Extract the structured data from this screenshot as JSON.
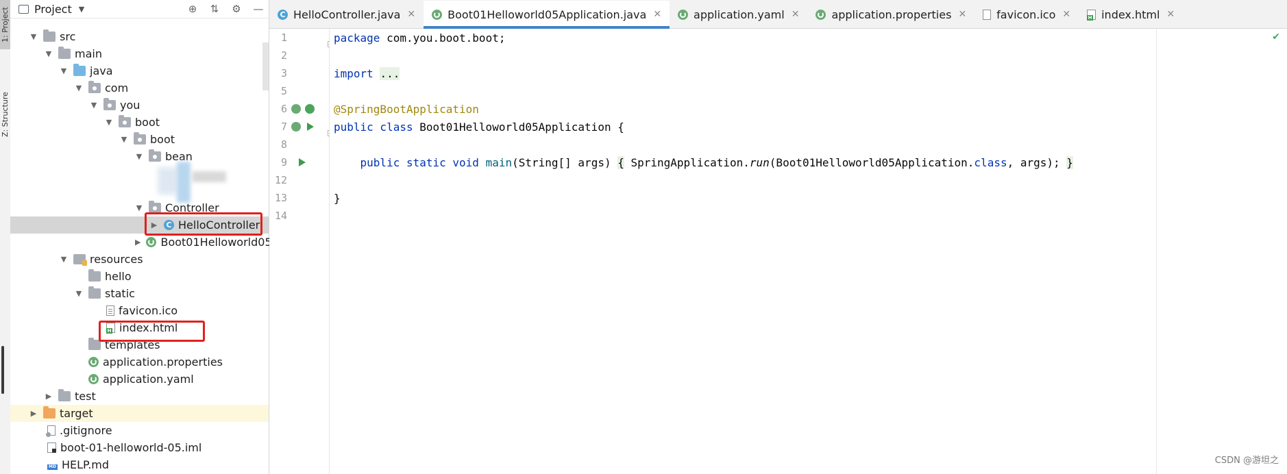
{
  "tool_strip": {
    "tabs": [
      "1: Project",
      "Z: Structure"
    ]
  },
  "project_panel": {
    "title": "Project",
    "tree": [
      {
        "label": "src",
        "icon": "folder",
        "expanded": true
      },
      {
        "label": "main",
        "icon": "folder",
        "expanded": true
      },
      {
        "label": "java",
        "icon": "source-folder",
        "expanded": true
      },
      {
        "label": "com",
        "icon": "package",
        "expanded": true
      },
      {
        "label": "you",
        "icon": "package",
        "expanded": true
      },
      {
        "label": "boot",
        "icon": "package",
        "expanded": true
      },
      {
        "label": "boot",
        "icon": "package",
        "expanded": true
      },
      {
        "label": "bean",
        "icon": "package",
        "expanded": true
      },
      {
        "label": "Controller",
        "icon": "package",
        "expanded": true
      },
      {
        "label": "HelloController",
        "icon": "class",
        "expanded": false,
        "selected": true
      },
      {
        "label": "Boot01Helloworld05",
        "icon": "spring-boot-class",
        "expanded": false
      },
      {
        "label": "resources",
        "icon": "resources-folder",
        "expanded": true
      },
      {
        "label": "hello",
        "icon": "folder"
      },
      {
        "label": "static",
        "icon": "folder",
        "expanded": true
      },
      {
        "label": "favicon.ico",
        "icon": "file"
      },
      {
        "label": "index.html",
        "icon": "html-file"
      },
      {
        "label": "templates",
        "icon": "folder"
      },
      {
        "label": "application.properties",
        "icon": "spring-config"
      },
      {
        "label": "application.yaml",
        "icon": "spring-config"
      },
      {
        "label": "test",
        "icon": "folder",
        "expanded": false
      },
      {
        "label": "target",
        "icon": "excluded-folder",
        "expanded": false
      },
      {
        "label": ".gitignore",
        "icon": "gitignore-file"
      },
      {
        "label": "boot-01-helloworld-05.iml",
        "icon": "iml-file"
      },
      {
        "label": "HELP.md",
        "icon": "markdown-file"
      }
    ]
  },
  "tabs": [
    {
      "label": "HelloController.java",
      "icon": "class",
      "active": false
    },
    {
      "label": "Boot01Helloworld05Application.java",
      "icon": "spring-boot-class",
      "active": true
    },
    {
      "label": "application.yaml",
      "icon": "spring-config",
      "active": false
    },
    {
      "label": "application.properties",
      "icon": "spring-config",
      "active": false
    },
    {
      "label": "favicon.ico",
      "icon": "file",
      "active": false
    },
    {
      "label": "index.html",
      "icon": "html-file",
      "active": false
    }
  ],
  "editor": {
    "line_numbers": [
      "1",
      "2",
      "3",
      "5",
      "6",
      "7",
      "8",
      "9",
      "12",
      "13",
      "14"
    ],
    "code": {
      "l1_kw": "package",
      "l1_rest": " com.you.boot.boot;",
      "l3_kw": "import",
      "l3_fold": "...",
      "l6_ann": "@SpringBootApplication",
      "l7_kw": "public class",
      "l7_rest": " Boot01Helloworld05Application {",
      "l9_kw": "public static void",
      "l9_fn": "main",
      "l9_args": "(String[] args) ",
      "l9_brace_open": "{",
      "l9_body1": " SpringApplication.",
      "l9_run": "run",
      "l9_body2": "(Boot01Helloworld05Application.",
      "l9_class_kw": "class",
      "l9_body3": ", args); ",
      "l9_brace_close": "}",
      "l13": "}"
    }
  },
  "watermark": "CSDN @游坦之"
}
